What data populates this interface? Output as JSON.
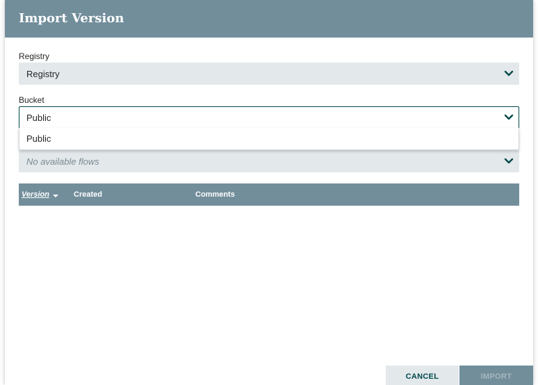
{
  "dialog": {
    "title": "Import Version"
  },
  "registry": {
    "label": "Registry",
    "value": "Registry"
  },
  "bucket": {
    "label": "Bucket",
    "value": "Public",
    "options": [
      "Public"
    ]
  },
  "flow": {
    "value": "No available flows"
  },
  "versions_table": {
    "columns": [
      {
        "label": "Version",
        "sorted": "descending"
      },
      {
        "label": "Created"
      },
      {
        "label": "Comments"
      }
    ],
    "rows": []
  },
  "buttons": {
    "cancel_label": "CANCEL",
    "import_label": "IMPORT"
  },
  "colors": {
    "header": "#728e9b",
    "accent": "#004849",
    "field_bg": "#e3e8eb"
  },
  "icons": {
    "combo_chevron": "chevron-down-icon",
    "sort_indicator": "sort-descending-icon"
  }
}
